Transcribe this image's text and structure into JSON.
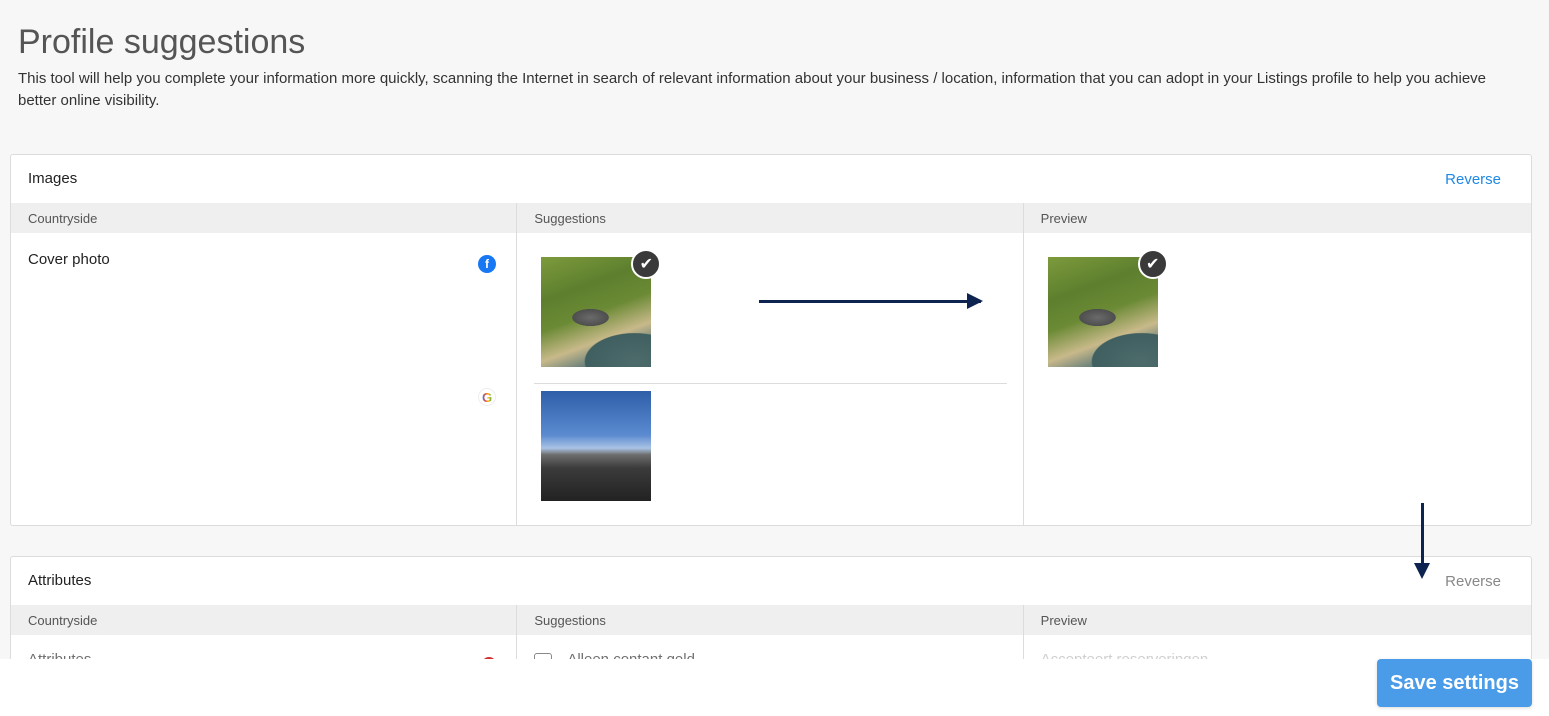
{
  "page": {
    "title": "Profile suggestions",
    "description": "This tool will help you complete your information more quickly, scanning the Internet in search of relevant information about your business / location, information that you can adopt in your Listings profile to help you achieve better online visibility."
  },
  "images_section": {
    "title": "Images",
    "reverse_label": "Reverse",
    "columns": [
      "Countryside",
      "Suggestions",
      "Preview"
    ],
    "row_label": "Cover photo",
    "sources": [
      {
        "icon": "facebook-icon",
        "glyph": "f"
      },
      {
        "icon": "google-icon",
        "glyph": "G"
      }
    ]
  },
  "attributes_section": {
    "title": "Attributes",
    "reverse_label": "Reverse",
    "columns": [
      "Countryside",
      "Suggestions",
      "Preview"
    ],
    "row_label": "Attributes",
    "suggestion_label": "Alleen contant geld",
    "preview_label": "Accepteert reserveringen"
  },
  "footer": {
    "save_label": "Save settings"
  },
  "colors": {
    "accent": "#1e88e5",
    "save_button": "#4a9be8",
    "arrow": "#0d2350"
  }
}
